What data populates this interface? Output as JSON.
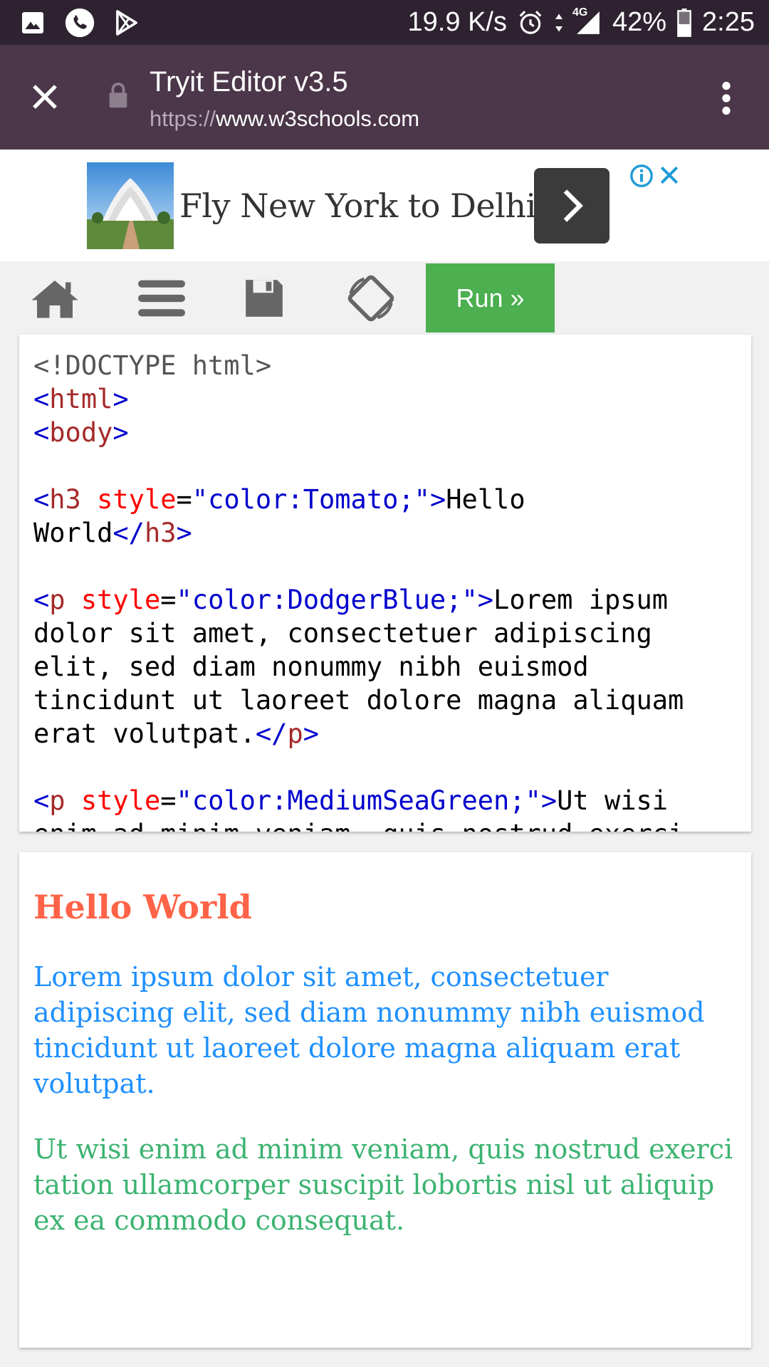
{
  "status_bar": {
    "network_speed": "19.9 K/s",
    "network_type": "4G",
    "battery": "42%",
    "time": "2:25",
    "icons": [
      "image-icon",
      "phone-icon",
      "play-store-icon",
      "alarm-icon",
      "data-arrows-icon",
      "signal-icon",
      "battery-icon"
    ]
  },
  "tab_header": {
    "title": "Tryit Editor v3.5",
    "url_scheme": "https://",
    "url_host": "www.w3schools.com"
  },
  "ad": {
    "text": "Fly New York to Delhi"
  },
  "toolbar": {
    "run_label": "Run »",
    "icons": [
      "home-icon",
      "menu-icon",
      "save-icon",
      "rotate-icon"
    ],
    "run_color": "#4caf50"
  },
  "code": {
    "doctype": "<!DOCTYPE html>",
    "h3_style": "\"color:Tomato;\"",
    "h3_text_1": "Hello",
    "h3_text_2": "World",
    "p1_style": "\"color:DodgerBlue;\"",
    "p1_text_1": "Lorem ipsum",
    "p1_text_2": "dolor sit amet, consectetuer adipiscing",
    "p1_text_3": "elit, sed diam nonummy nibh euismod",
    "p1_text_4": "tincidunt ut laoreet dolore magna aliquam",
    "p1_text_5": "erat volutpat.",
    "p2_style": "\"color:MediumSeaGreen;\"",
    "p2_text_1": "Ut wisi",
    "p2_text_2": "enim ad minim veniam, quis nostrud exerci"
  },
  "result": {
    "heading": "Hello World",
    "para1": "Lorem ipsum dolor sit amet, consectetuer adipiscing elit, sed diam nonummy nibh euismod tincidunt ut laoreet dolore magna aliquam erat volutpat.",
    "para2": "Ut wisi enim ad minim veniam, quis nostrud exerci tation ullamcorper suscipit lobortis nisl ut aliquip ex ea commodo consequat."
  },
  "colors": {
    "status_bar_bg": "#2e2230",
    "header_bg": "#4b3749",
    "tomato": "#ff6347",
    "dodgerblue": "#1e90ff",
    "mediumseagreen": "#3cb371"
  }
}
